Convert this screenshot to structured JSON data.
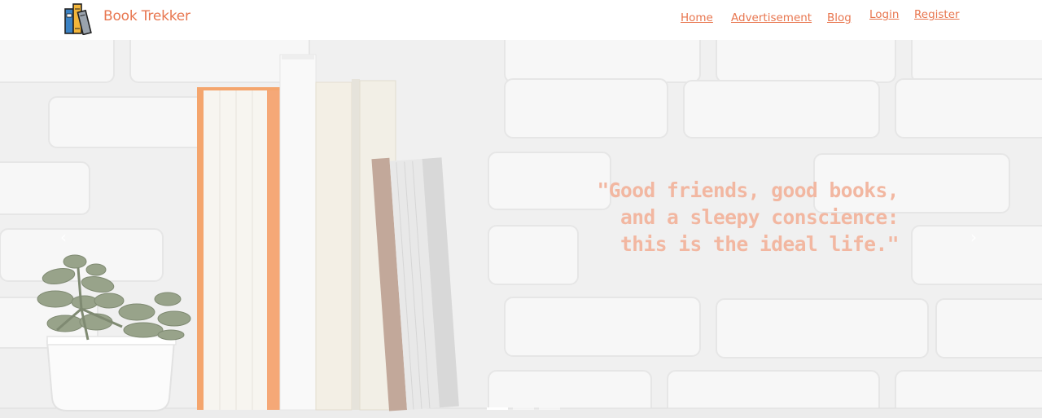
{
  "brand": {
    "name": "Book Trekker",
    "logo_icon": "books-icon"
  },
  "nav": {
    "home": "Home",
    "advertisement": "Advertisement",
    "blog": "Blog",
    "login": "Login",
    "register": "Register"
  },
  "hero": {
    "quote_lines": [
      "\"Good friends, good books,",
      "and a sleepy conscience:",
      "this is the ideal life.\""
    ],
    "slide_count": 3,
    "active_slide": 1
  },
  "colors": {
    "accent": "#e8764f",
    "quote": "#f2b7a1",
    "background": "#f1f1f1"
  }
}
